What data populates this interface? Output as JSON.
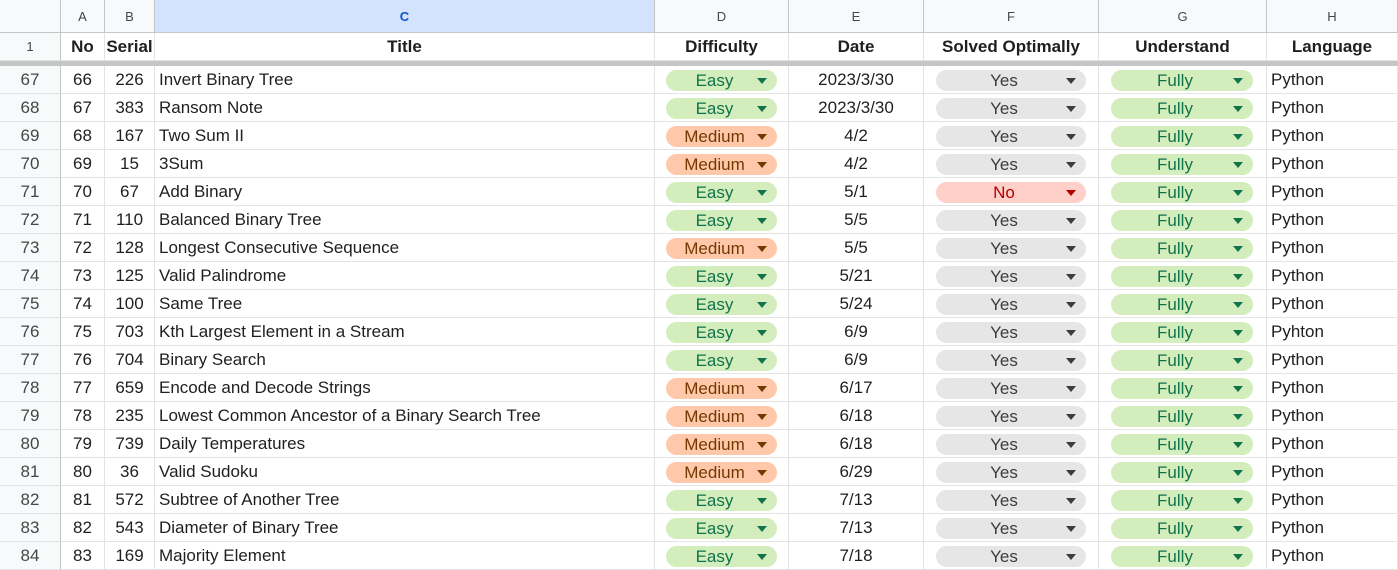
{
  "column_headers": [
    "A",
    "B",
    "C",
    "D",
    "E",
    "F",
    "G",
    "H"
  ],
  "selected_column": "C",
  "header_row": {
    "row_number": "1",
    "cells": [
      "No",
      "Serial",
      "Title",
      "Difficulty",
      "Date",
      "Solved Optimally",
      "Understand",
      "Language"
    ]
  },
  "rows": [
    {
      "r": "67",
      "no": "66",
      "serial": "226",
      "title": "Invert Binary Tree",
      "difficulty": "Easy",
      "date": "2023/3/30",
      "solved": "Yes",
      "understand": "Fully",
      "language": "Python"
    },
    {
      "r": "68",
      "no": "67",
      "serial": "383",
      "title": "Ransom Note",
      "difficulty": "Easy",
      "date": "2023/3/30",
      "solved": "Yes",
      "understand": "Fully",
      "language": "Python"
    },
    {
      "r": "69",
      "no": "68",
      "serial": "167",
      "title": "Two Sum II",
      "difficulty": "Medium",
      "date": "4/2",
      "solved": "Yes",
      "understand": "Fully",
      "language": "Python"
    },
    {
      "r": "70",
      "no": "69",
      "serial": "15",
      "title": "3Sum",
      "difficulty": "Medium",
      "date": "4/2",
      "solved": "Yes",
      "understand": "Fully",
      "language": "Python"
    },
    {
      "r": "71",
      "no": "70",
      "serial": "67",
      "title": "Add Binary",
      "difficulty": "Easy",
      "date": "5/1",
      "solved": "No",
      "understand": "Fully",
      "language": "Python"
    },
    {
      "r": "72",
      "no": "71",
      "serial": "110",
      "title": "Balanced Binary Tree",
      "difficulty": "Easy",
      "date": "5/5",
      "solved": "Yes",
      "understand": "Fully",
      "language": "Python"
    },
    {
      "r": "73",
      "no": "72",
      "serial": "128",
      "title": "Longest Consecutive Sequence",
      "difficulty": "Medium",
      "date": "5/5",
      "solved": "Yes",
      "understand": "Fully",
      "language": "Python"
    },
    {
      "r": "74",
      "no": "73",
      "serial": "125",
      "title": "Valid Palindrome",
      "difficulty": "Easy",
      "date": "5/21",
      "solved": "Yes",
      "understand": "Fully",
      "language": "Python"
    },
    {
      "r": "75",
      "no": "74",
      "serial": "100",
      "title": "Same Tree",
      "difficulty": "Easy",
      "date": "5/24",
      "solved": "Yes",
      "understand": "Fully",
      "language": "Python"
    },
    {
      "r": "76",
      "no": "75",
      "serial": "703",
      "title": "Kth Largest Element in a Stream",
      "difficulty": "Easy",
      "date": "6/9",
      "solved": "Yes",
      "understand": "Fully",
      "language": "Pyhton"
    },
    {
      "r": "77",
      "no": "76",
      "serial": "704",
      "title": "Binary Search",
      "difficulty": "Easy",
      "date": "6/9",
      "solved": "Yes",
      "understand": "Fully",
      "language": "Python"
    },
    {
      "r": "78",
      "no": "77",
      "serial": "659",
      "title": "Encode and Decode Strings",
      "difficulty": "Medium",
      "date": "6/17",
      "solved": "Yes",
      "understand": "Fully",
      "language": "Python"
    },
    {
      "r": "79",
      "no": "78",
      "serial": "235",
      "title": "Lowest Common Ancestor of a Binary Search Tree",
      "difficulty": "Medium",
      "date": "6/18",
      "solved": "Yes",
      "understand": "Fully",
      "language": "Python"
    },
    {
      "r": "80",
      "no": "79",
      "serial": "739",
      "title": "Daily Temperatures",
      "difficulty": "Medium",
      "date": "6/18",
      "solved": "Yes",
      "understand": "Fully",
      "language": "Python"
    },
    {
      "r": "81",
      "no": "80",
      "serial": "36",
      "title": "Valid Sudoku",
      "difficulty": "Medium",
      "date": "6/29",
      "solved": "Yes",
      "understand": "Fully",
      "language": "Python"
    },
    {
      "r": "82",
      "no": "81",
      "serial": "572",
      "title": "Subtree of Another Tree",
      "difficulty": "Easy",
      "date": "7/13",
      "solved": "Yes",
      "understand": "Fully",
      "language": "Python"
    },
    {
      "r": "83",
      "no": "82",
      "serial": "543",
      "title": "Diameter of Binary Tree",
      "difficulty": "Easy",
      "date": "7/13",
      "solved": "Yes",
      "understand": "Fully",
      "language": "Python"
    },
    {
      "r": "84",
      "no": "83",
      "serial": "169",
      "title": "Majority Element",
      "difficulty": "Easy",
      "date": "7/18",
      "solved": "Yes",
      "understand": "Fully",
      "language": "Python"
    }
  ],
  "chip_colors": {
    "Easy": "#d4edbc",
    "Medium": "#ffc8aa",
    "Yes": "#e6e6e6",
    "No": "#ffcfc9",
    "Fully": "#d4edbc"
  }
}
